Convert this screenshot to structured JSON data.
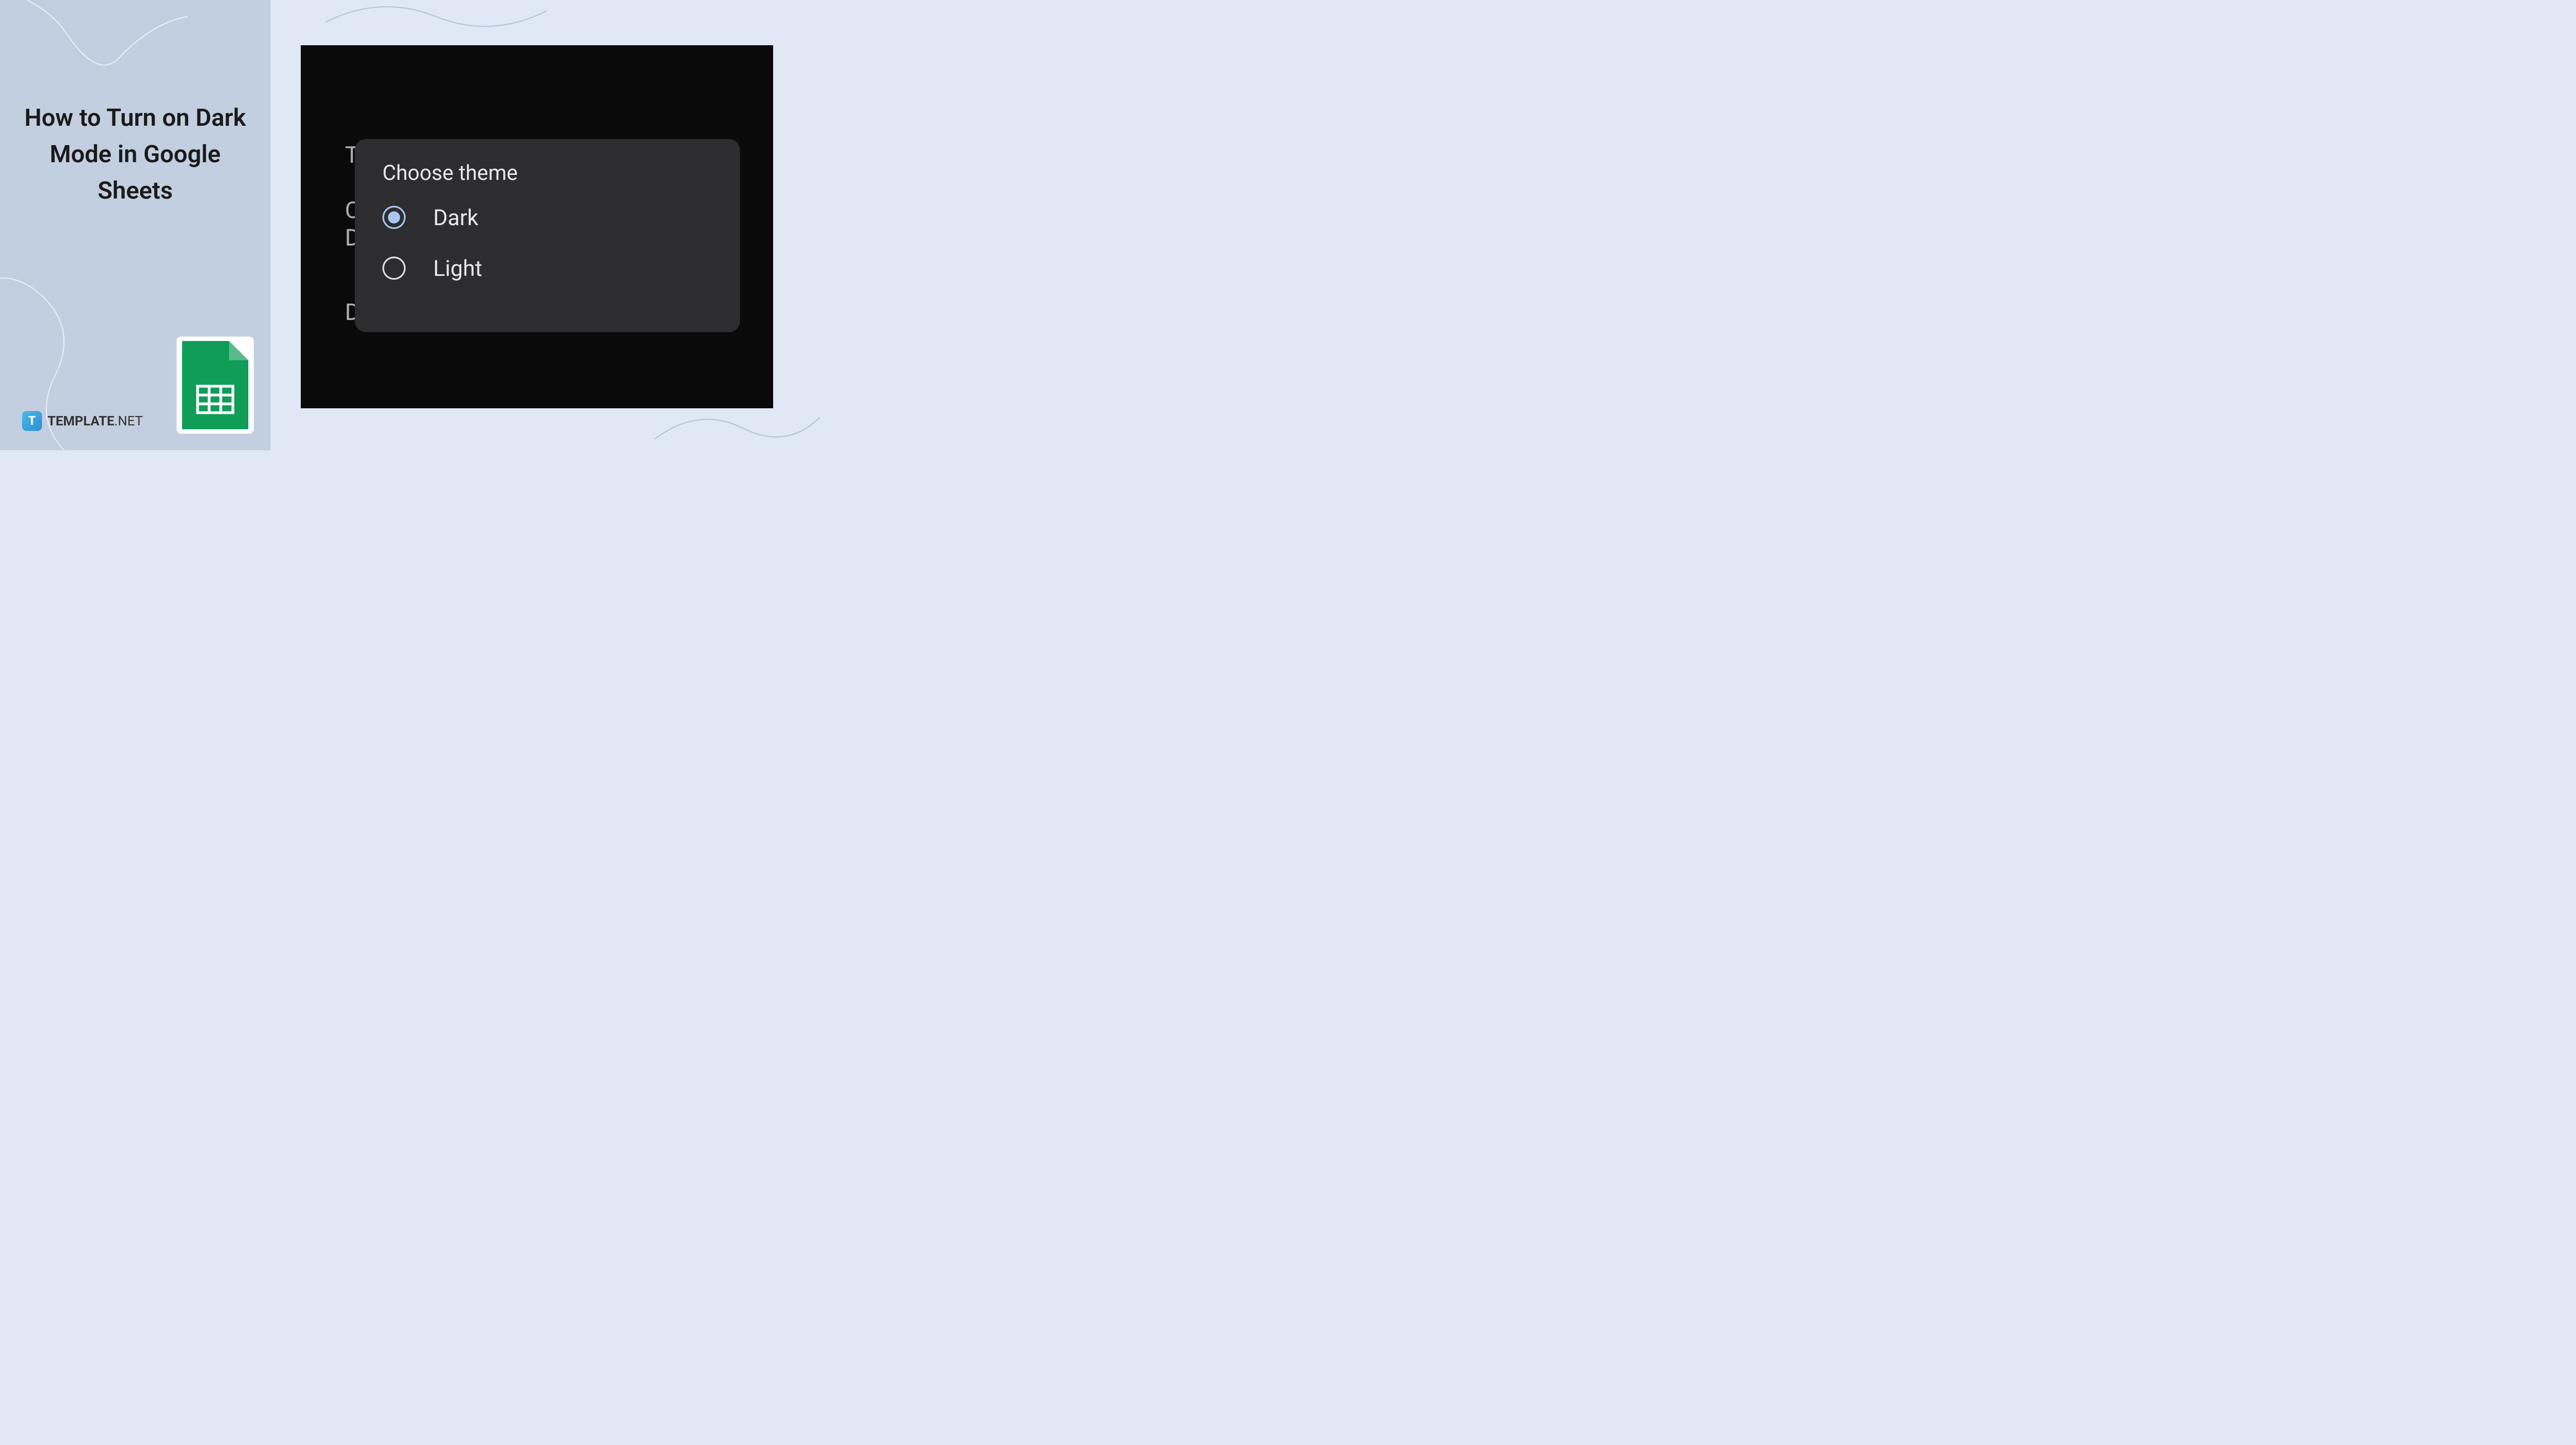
{
  "article": {
    "title": "How to Turn on Dark Mode in Google Sheets"
  },
  "brand": {
    "icon_letter": "T",
    "name": "TEMPLATE",
    "suffix": ".NET"
  },
  "background_labels": {
    "theme": "T",
    "c": "C",
    "d1": "D",
    "d2": "D"
  },
  "dialog": {
    "title": "Choose theme",
    "options": [
      {
        "label": "Dark",
        "selected": true
      },
      {
        "label": "Light",
        "selected": false
      }
    ]
  }
}
